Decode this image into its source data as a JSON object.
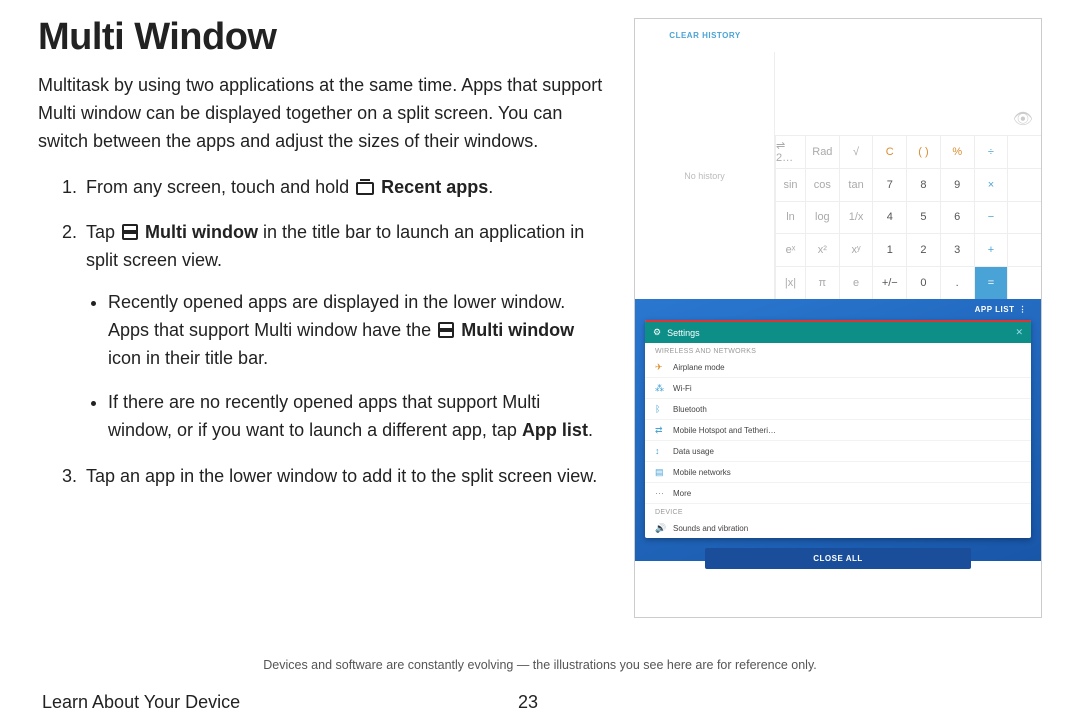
{
  "heading": "Multi Window",
  "intro": "Multitask by using two applications at the same time. Apps that support Multi window can be displayed together on a split screen. You can switch between the apps and adjust the sizes of their windows.",
  "steps": {
    "s1_a": "From any screen, touch and hold ",
    "s1_b": "Recent apps",
    "s1_c": ".",
    "s2_a": "Tap ",
    "s2_b": "Multi window",
    "s2_c": " in the title bar to launch an application in split screen view.",
    "s2_bul1_a": "Recently opened apps are displayed in the lower window. Apps that support Multi window have the ",
    "s2_bul1_b": "Multi window",
    "s2_bul1_c": " icon in their title bar.",
    "s2_bul2_a": "If there are no recently opened apps that support Multi window, or if you want to launch a different app, tap ",
    "s2_bul2_b": "App list",
    "s2_bul2_c": ".",
    "s3": "Tap an app in the lower window to add it to the split screen view."
  },
  "device": {
    "clear_history": "CLEAR HISTORY",
    "no_history": "No history",
    "disp": "⇌ 2…",
    "keys_row0": [
      "Rad",
      "√",
      "C",
      "( )",
      "%",
      "÷"
    ],
    "keys_row1": [
      "sin",
      "cos",
      "tan",
      "7",
      "8",
      "9",
      "×"
    ],
    "keys_row2": [
      "ln",
      "log",
      "1/x",
      "4",
      "5",
      "6",
      "−"
    ],
    "keys_row3": [
      "eˣ",
      "x²",
      "xʸ",
      "1",
      "2",
      "3",
      "+"
    ],
    "keys_row4": [
      "|x|",
      "π",
      "e",
      "+/−",
      "0",
      ".",
      "="
    ],
    "applist": "APP LIST",
    "settings_title": "Settings",
    "section": "WIRELESS AND NETWORKS",
    "rows": [
      "Airplane mode",
      "Wi-Fi",
      "Bluetooth",
      "Mobile Hotspot and Tetheri…",
      "Data usage",
      "Mobile networks",
      "More"
    ],
    "section2": "DEVICE",
    "row_dev": "Sounds and vibration",
    "closeall": "CLOSE ALL"
  },
  "disclaimer": "Devices and software are constantly evolving — the illustrations you see here are for reference only.",
  "footer_section": "Learn About Your Device",
  "page_number": "23"
}
